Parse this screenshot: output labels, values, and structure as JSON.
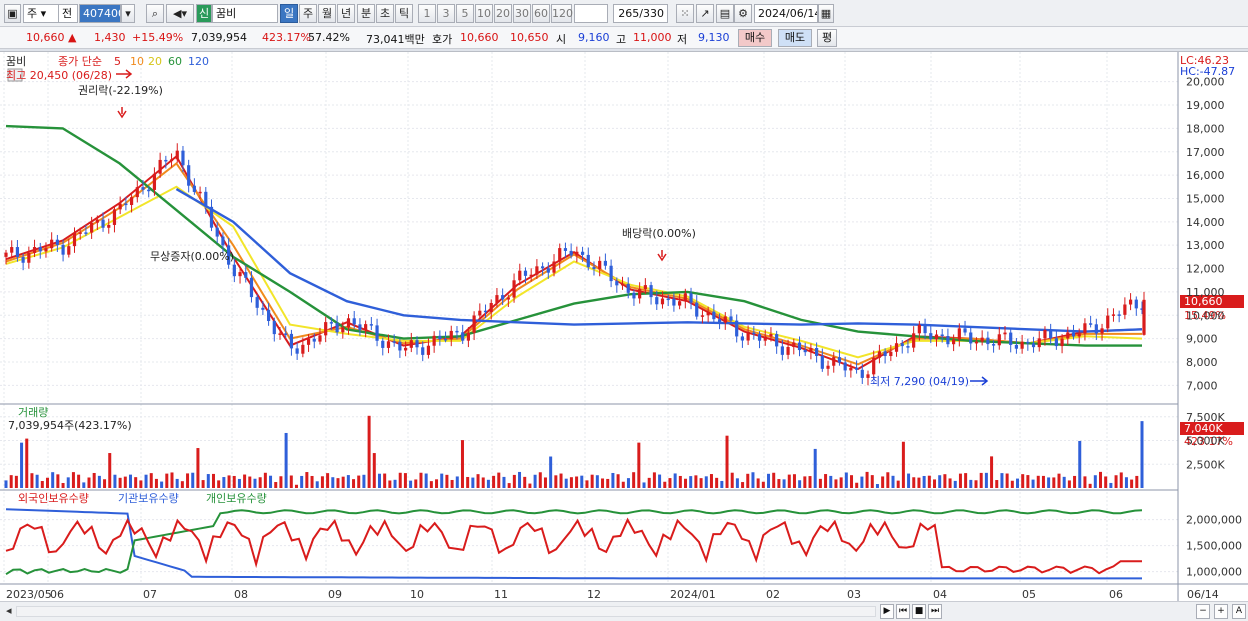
{
  "toolbar": {
    "market": "주",
    "kind": "전",
    "code": "407400",
    "new_badge": "신",
    "name": "꿈비",
    "periods": [
      "일",
      "주",
      "월",
      "년",
      "분",
      "초",
      "틱"
    ],
    "selected_period": "일",
    "intervals": [
      "1",
      "3",
      "5",
      "10",
      "20",
      "30",
      "60",
      "120"
    ],
    "count": "265",
    "total": "/330",
    "date": "2024/06/14"
  },
  "quote": {
    "price": "10,660",
    "change": "1,430",
    "change_pct": "+15.49%",
    "volume": "7,039,954",
    "vol_ratio": "423.17%",
    "turnover": "57.42%",
    "amount": "73,041백만",
    "bid_label": "호가",
    "bid1": "10,660",
    "bid2": "10,650",
    "open_label": "시",
    "open": "9,160",
    "high_label": "고",
    "high": "11,000",
    "low_label": "저",
    "low": "9,130",
    "buy_label": "매수",
    "sell_label": "매도",
    "eval_label": "평"
  },
  "price_panel": {
    "title": "꿈비",
    "legend_main": "종가 단순",
    "legend_periods": [
      "5",
      "10",
      "20",
      "60",
      "120"
    ],
    "legend_colors": [
      "#d91c1c",
      "#f08a1c",
      "#f2e52a",
      "#26923a",
      "#2f5fd9"
    ],
    "high_marker": "최고 20,450 (06/28)",
    "low_marker": "최저 7,290 (04/19)",
    "event1": "권리락(-22.19%)",
    "event2": "무상증자(0.00%)",
    "event3": "배당락(0.00%)",
    "lc": "LC:46.23",
    "hc": "HC:-47.87",
    "y_ticks": [
      "20,000",
      "19,000",
      "18,000",
      "17,000",
      "16,000",
      "15,000",
      "14,000",
      "13,000",
      "12,000",
      "11,000",
      "10,000",
      "9,000",
      "8,000",
      "7,000"
    ],
    "last_price_tag": "10,660",
    "last_pct_tag": "15.49%"
  },
  "volume_panel": {
    "title": "거래량",
    "value_line": "7,039,954주(423.17%)",
    "y_ticks": [
      "7,500K",
      "5,000K",
      "2,500K"
    ],
    "last_tag": "7,040K",
    "last_pct": "423.17%"
  },
  "holding_panel": {
    "labels": [
      "외국인보유수량",
      "기관보유수량",
      "개인보유수량"
    ],
    "colors": [
      "#d91c1c",
      "#2f5fd9",
      "#26923a"
    ],
    "y_ticks": [
      "2,000,000",
      "1,500,000",
      "1,000,000"
    ]
  },
  "x_labels": [
    "2023/05",
    "06",
    "07",
    "08",
    "09",
    "10",
    "11",
    "12",
    "2024/01",
    "02",
    "03",
    "04",
    "05",
    "06",
    "06/14"
  ],
  "chart_data": {
    "type": "line",
    "title": "꿈비",
    "ylim": [
      6500,
      20500
    ],
    "x_months": [
      "2023/05",
      "06",
      "07",
      "08",
      "09",
      "10",
      "11",
      "12",
      "2024/01",
      "02",
      "03",
      "04",
      "05",
      "06"
    ],
    "close_approx": [
      12500,
      13000,
      14500,
      17000,
      12000,
      8500,
      9800,
      8500,
      9200,
      11500,
      12800,
      11000,
      10500,
      9200,
      8500,
      7500,
      9200,
      9000,
      8800,
      9300,
      10660
    ],
    "series": [
      {
        "name": "5",
        "values": [
          12400,
          13200,
          14800,
          16800,
          12500,
          8700,
          9700,
          8700,
          9100,
          11300,
          12700,
          11100,
          10600,
          9300,
          8600,
          7700,
          9100,
          9000,
          8800,
          9300,
          9400
        ]
      },
      {
        "name": "10",
        "values": [
          12300,
          13100,
          14600,
          16500,
          13000,
          9000,
          9500,
          8800,
          9000,
          11100,
          12600,
          11200,
          10700,
          9400,
          8700,
          7900,
          9000,
          9000,
          8800,
          9200,
          9200
        ]
      },
      {
        "name": "20",
        "values": [
          12200,
          12900,
          14200,
          15500,
          13800,
          9600,
          9200,
          8900,
          8900,
          10800,
          12300,
          11300,
          10800,
          9500,
          8900,
          8200,
          8900,
          8900,
          8800,
          9100,
          9000
        ]
      },
      {
        "name": "60",
        "values": [
          18100,
          18000,
          16500,
          14500,
          12500,
          11000,
          9400,
          9000,
          9100,
          9800,
          10500,
          10900,
          11000,
          10600,
          9800,
          9300,
          9100,
          8900,
          8800,
          8700,
          8700
        ]
      },
      {
        "name": "120",
        "values": [
          null,
          null,
          null,
          15400,
          14000,
          11800,
          10600,
          10000,
          9800,
          9700,
          9600,
          9650,
          9700,
          9650,
          9600,
          9650,
          9600,
          9500,
          9400,
          9300,
          9400
        ]
      }
    ]
  }
}
